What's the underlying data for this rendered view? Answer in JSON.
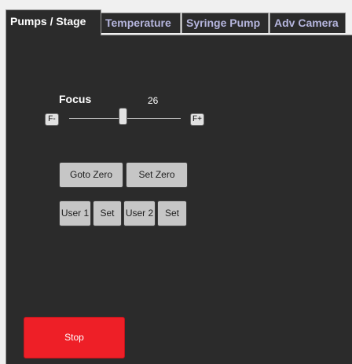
{
  "tabs": [
    {
      "label": "Pumps / Stage",
      "active": true
    },
    {
      "label": "Temperature",
      "active": false
    },
    {
      "label": "Syringe Pump",
      "active": false
    },
    {
      "label": "Adv Camera",
      "active": false
    }
  ],
  "focus": {
    "label": "Focus",
    "value": "26",
    "minus_label": "F-",
    "plus_label": "F+"
  },
  "buttons": {
    "goto_zero": "Goto Zero",
    "set_zero": "Set Zero",
    "user1": "User 1",
    "set1": "Set",
    "user2": "User 2",
    "set2": "Set",
    "stop": "Stop"
  },
  "colors": {
    "panel_bg": "#2b2b2b",
    "stop": "#ee1f27",
    "inactive_tab_text": "#b6b6de"
  }
}
